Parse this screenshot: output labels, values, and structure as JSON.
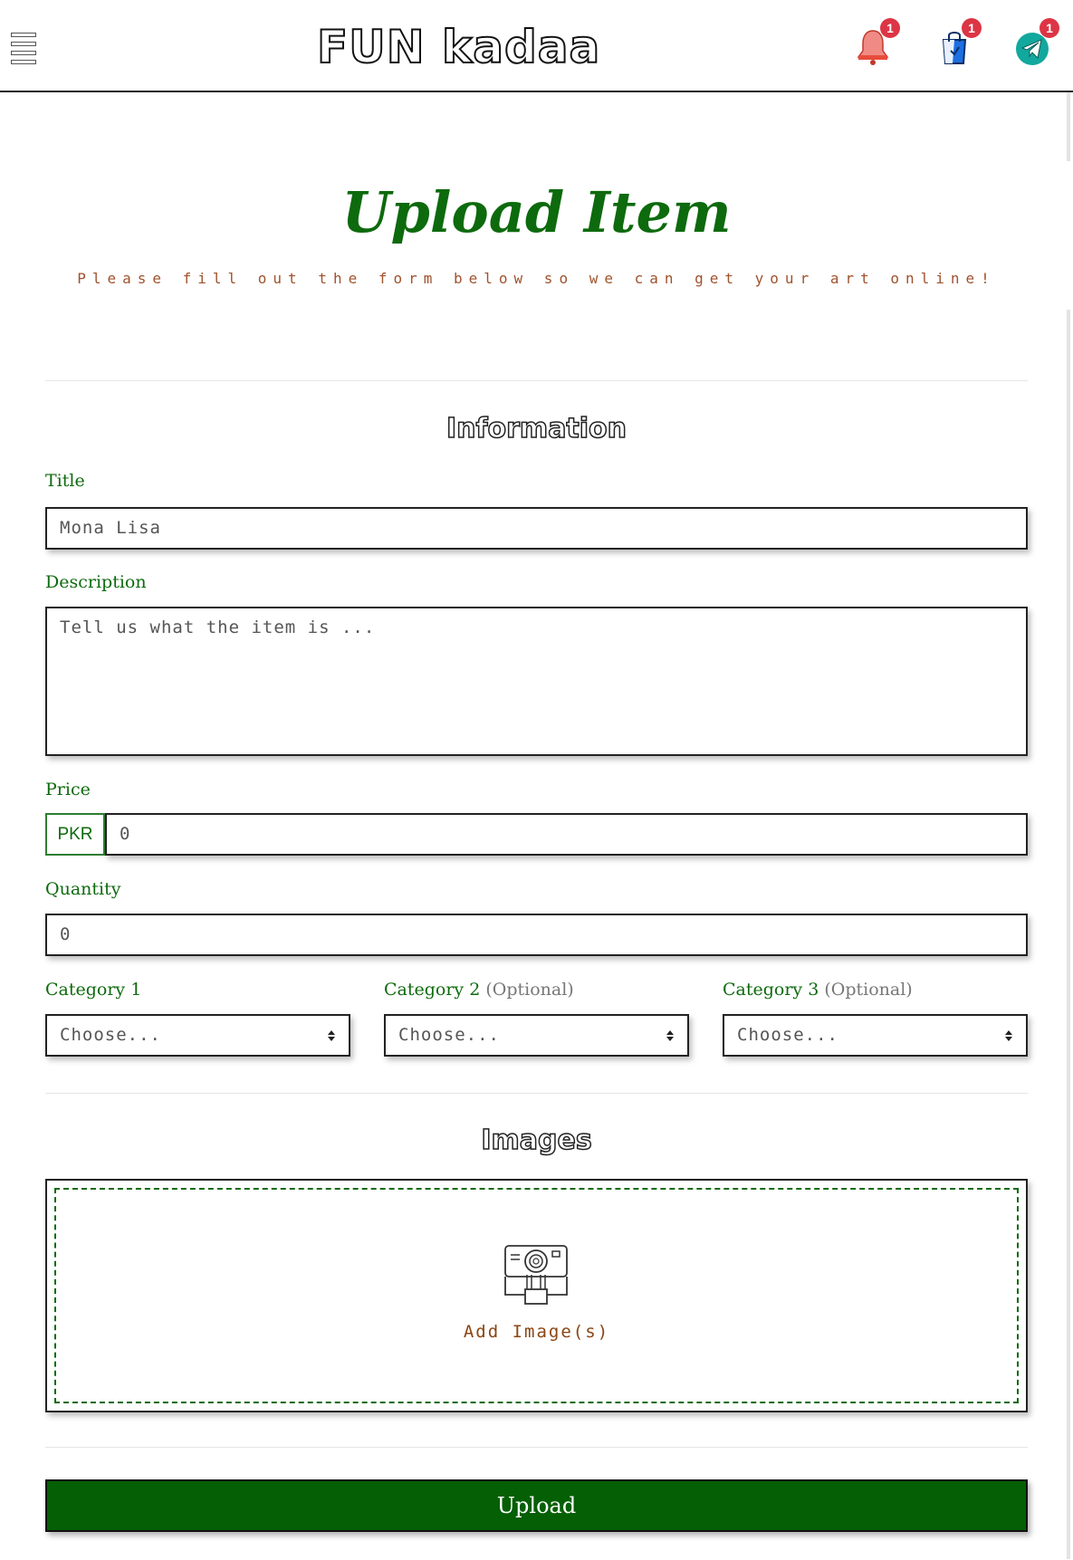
{
  "navbar": {
    "brand": "FUN kadaa",
    "notifications_count": "1",
    "cart_count": "1",
    "messages_count": "1"
  },
  "header": {
    "title": "Upload Item",
    "subtitle": "Please fill out the form below so we can get your art online!"
  },
  "information": {
    "section_title": "Information",
    "title_label": "Title",
    "title_placeholder": "Mona Lisa",
    "description_label": "Description",
    "description_placeholder": "Tell us what the item is ...",
    "price_label": "Price",
    "price_prefix": "PKR",
    "price_placeholder": "0",
    "quantity_label": "Quantity",
    "quantity_placeholder": "0",
    "category1_label": "Category 1",
    "category2_label": "Category 2",
    "category3_label": "Category 3",
    "optional_note": "(Optional)",
    "category_selected": "Choose..."
  },
  "images": {
    "section_title": "Images",
    "add_label": "Add Image(s)"
  },
  "upload_label": "Upload",
  "colors": {
    "accent_green": "#0d6a0d",
    "button_green": "#055f05",
    "subtitle_brown": "#a0522d",
    "badge_red": "#dc3545"
  }
}
